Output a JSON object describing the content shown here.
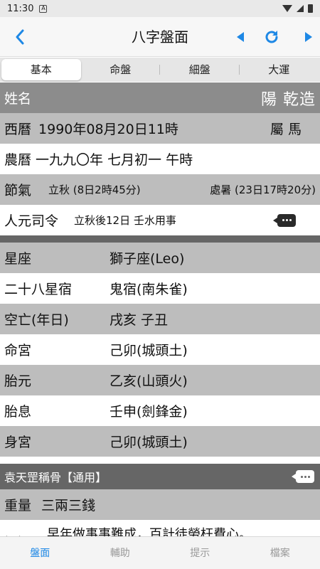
{
  "status_bar": {
    "time": "11:30",
    "icon": "A"
  },
  "header": {
    "title": "八字盤面"
  },
  "tabs": [
    "基本",
    "命盤",
    "細盤",
    "大運"
  ],
  "profile": {
    "name_label": "姓名",
    "gender": "陽 乾造",
    "western_label": "西曆",
    "western_date": "1990年08月20日11時",
    "zodiac": "屬 馬",
    "lunar_label": "農曆",
    "lunar_date": "一九九〇年 七月初一 午時",
    "solar_term_label": "節氣",
    "solar_term_1": "立秋 (8日2時45分)",
    "solar_term_2": "處暑 (23日17時20分)",
    "renyuan_label": "人元司令",
    "renyuan_value": "立秋後12日 壬水用事"
  },
  "details": [
    {
      "label": "星座",
      "value": "獅子座(Leo)"
    },
    {
      "label": "二十八星宿",
      "value": "鬼宿(南朱雀)"
    },
    {
      "label": "空亡(年日)",
      "value": "戌亥 子丑"
    },
    {
      "label": "命宮",
      "value": "己卯(城頭土)"
    },
    {
      "label": "胎元",
      "value": "乙亥(山頭火)"
    },
    {
      "label": "胎息",
      "value": "壬申(劍鋒金)"
    },
    {
      "label": "身宮",
      "value": "己卯(城頭土)"
    }
  ],
  "bone_weight": {
    "header": "袁天罡稱骨【通用】",
    "weight_label": "重量",
    "weight_value": "三兩三錢",
    "comment_label": "評語",
    "comment_text": "早年做事事難成，百計徒勞枉費心。"
  },
  "bottom_tabs": [
    "盤面",
    "輔助",
    "提示",
    "檔案"
  ],
  "colors": {
    "accent": "#1e88e5",
    "row_gray": "#bdbdbd",
    "header_dark": "#666666"
  }
}
